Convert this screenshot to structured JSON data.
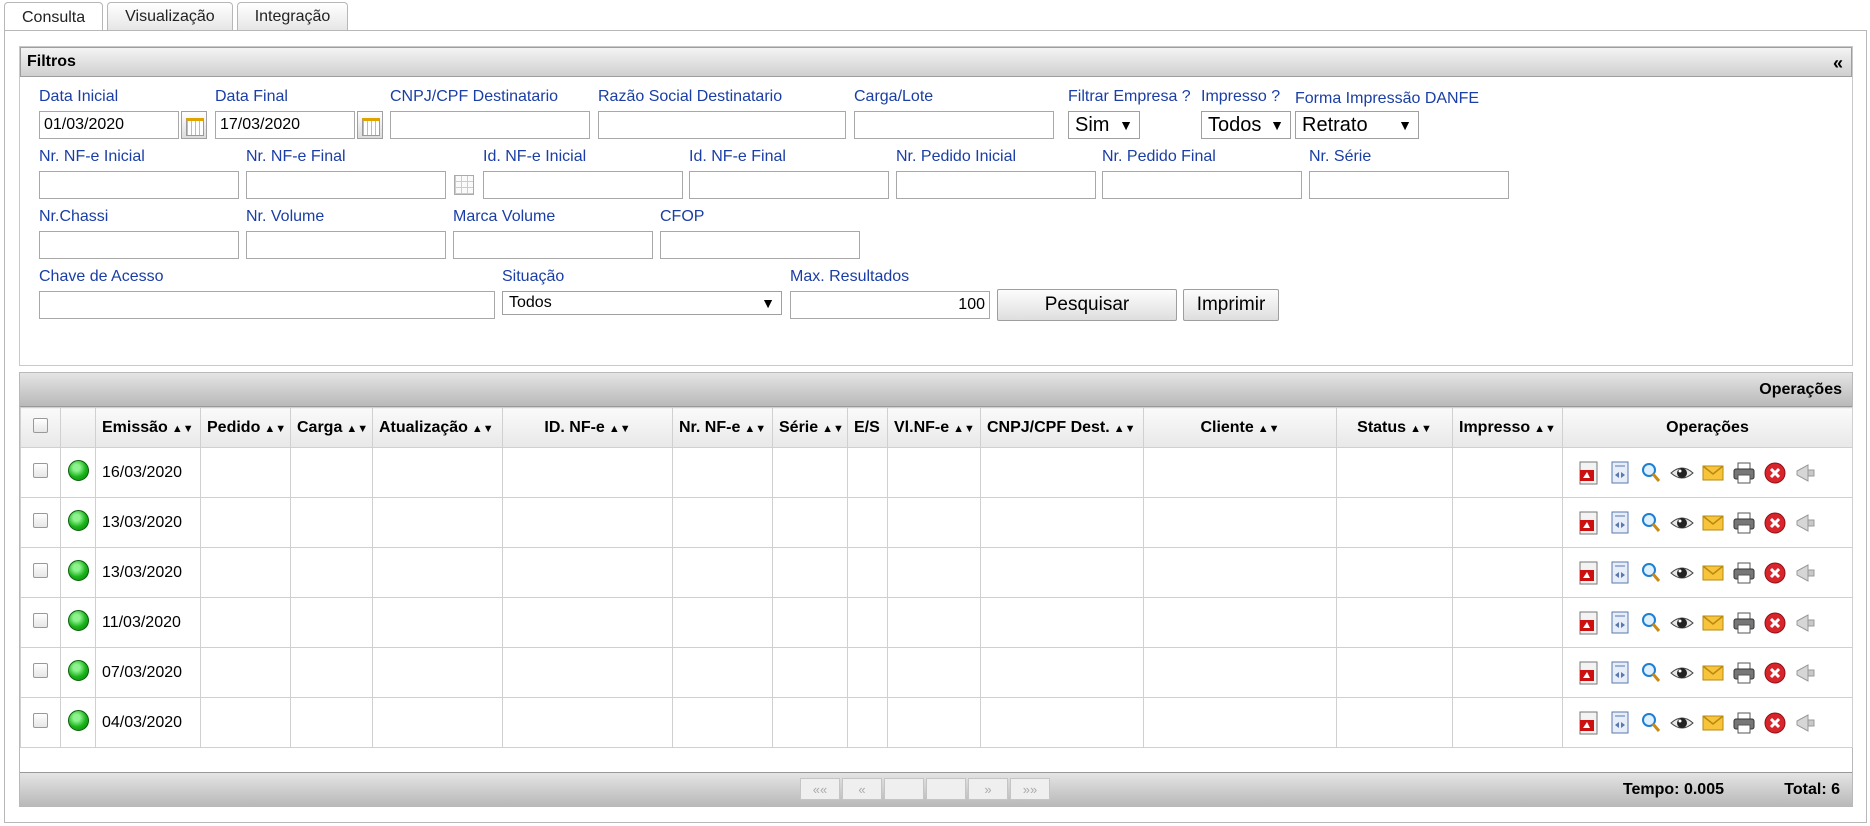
{
  "tabs": [
    {
      "label": "Consulta"
    },
    {
      "label": "Visualização"
    },
    {
      "label": "Integração"
    }
  ],
  "filters": {
    "title": "Filtros",
    "collapse_label": "«",
    "data_inicial": {
      "label": "Data Inicial",
      "value": "01/03/2020"
    },
    "data_final": {
      "label": "Data Final",
      "value": "17/03/2020"
    },
    "cnpj": {
      "label": "CNPJ/CPF Destinatario",
      "value": ""
    },
    "razao": {
      "label": "Razão Social Destinatario",
      "value": ""
    },
    "carga": {
      "label": "Carga/Lote",
      "value": ""
    },
    "filtrar_empresa": {
      "label": "Filtrar Empresa ?",
      "value": "Sim"
    },
    "impresso": {
      "label": "Impresso ?",
      "value": "Todos"
    },
    "forma_impressao": {
      "label": "Forma Impressão DANFE",
      "value": "Retrato"
    },
    "nr_nfe_inicial": {
      "label": "Nr. NF-e Inicial",
      "value": ""
    },
    "nr_nfe_final": {
      "label": "Nr. NF-e Final",
      "value": ""
    },
    "id_nfe_inicial": {
      "label": "Id. NF-e Inicial",
      "value": ""
    },
    "id_nfe_final": {
      "label": "Id. NF-e Final",
      "value": ""
    },
    "nr_pedido_inicial": {
      "label": "Nr. Pedido Inicial",
      "value": ""
    },
    "nr_pedido_final": {
      "label": "Nr. Pedido Final",
      "value": ""
    },
    "nr_serie": {
      "label": "Nr. Série",
      "value": ""
    },
    "nr_chassi": {
      "label": "Nr.Chassi",
      "value": ""
    },
    "nr_volume": {
      "label": "Nr. Volume",
      "value": ""
    },
    "marca_volume": {
      "label": "Marca Volume",
      "value": ""
    },
    "cfop": {
      "label": "CFOP",
      "value": ""
    },
    "chave_acesso": {
      "label": "Chave de Acesso",
      "value": ""
    },
    "situacao": {
      "label": "Situação",
      "value": "Todos"
    },
    "max_resultados": {
      "label": "Max. Resultados",
      "value": "100"
    },
    "pesquisar_label": "Pesquisar",
    "imprimir_label": "Imprimir"
  },
  "results": {
    "title": "Operações",
    "columns": [
      "Emissão",
      "Pedido",
      "Carga",
      "Atualização",
      "ID. NF-e",
      "Nr. NF-e",
      "Série",
      "E/S",
      "Vl.NF-e",
      "CNPJ/CPF Dest.",
      "Cliente",
      "Status",
      "Impresso",
      "Operações"
    ],
    "rows": [
      {
        "emissao": "16/03/2020"
      },
      {
        "emissao": "13/03/2020"
      },
      {
        "emissao": "13/03/2020"
      },
      {
        "emissao": "11/03/2020"
      },
      {
        "emissao": "07/03/2020"
      },
      {
        "emissao": "04/03/2020"
      }
    ],
    "operation_icons": [
      "pdf-icon",
      "xml-document-icon",
      "magnifier-icon",
      "eye-icon",
      "envelope-icon",
      "printer-icon",
      "cancel-icon",
      "megaphone-icon"
    ],
    "status_color": "#1bb51b"
  },
  "footer": {
    "pager": [
      "««",
      "«",
      "",
      "",
      "»",
      "»»"
    ],
    "tempo": "Tempo: 0.005",
    "total": "Total: 6"
  }
}
